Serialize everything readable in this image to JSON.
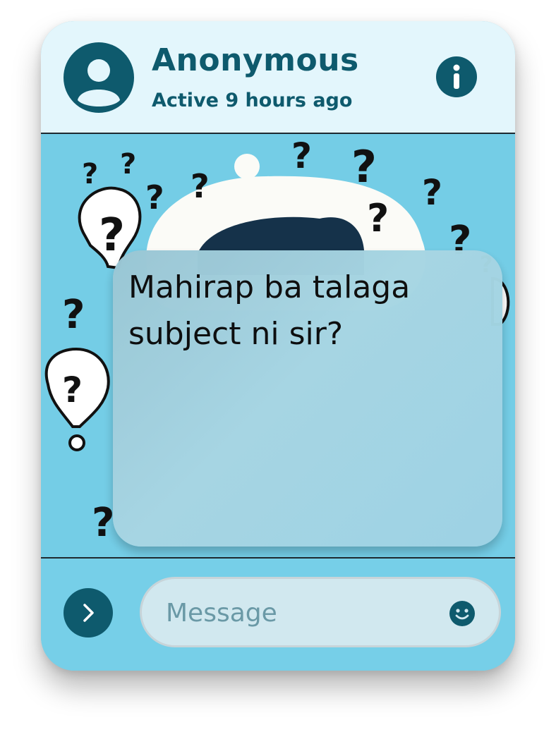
{
  "header": {
    "name": "Anonymous",
    "status": "Active 9 hours ago",
    "avatar_icon": "user-avatar-icon",
    "info_icon": "info-icon"
  },
  "message": {
    "text": "Mahirap ba talaga subject ni sir?"
  },
  "composer": {
    "placeholder": "Message",
    "send_icon": "chevron-right-icon",
    "emoji_icon": "smiley-icon"
  },
  "colors": {
    "primary": "#0e5a6d",
    "header_bg": "#e3f6fc",
    "scene_bg": "#74cde6",
    "bubble_bg": "#a7d6e3",
    "input_bg": "#d1e8ef"
  }
}
